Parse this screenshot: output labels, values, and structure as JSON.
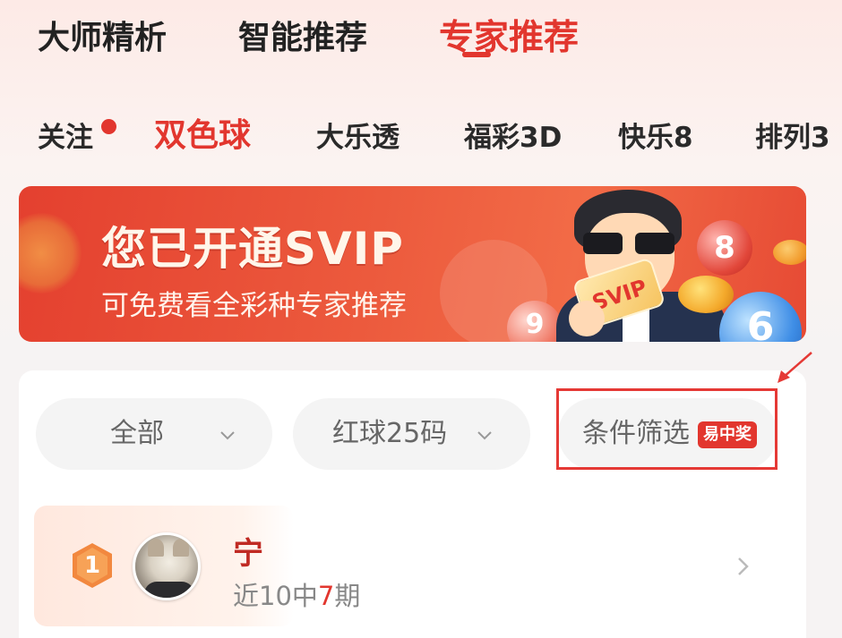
{
  "main_tabs": [
    "大师精析",
    "智能推荐",
    "专家推荐"
  ],
  "main_tab_active_index": 2,
  "lottery_tabs": [
    "关注",
    "双色球",
    "大乐透",
    "福彩3D",
    "快乐8",
    "排列3"
  ],
  "lottery_tab_active_index": 1,
  "banner": {
    "title": "您已开通SVIP",
    "subtitle": "可免费看全彩种专家推荐",
    "card_text": "SVIP",
    "balls": [
      "8",
      "6",
      "9"
    ]
  },
  "filters": {
    "category": "全部",
    "mode": "红球25码",
    "condition": "条件筛选",
    "condition_badge": "易中奖"
  },
  "experts": [
    {
      "rank": "1",
      "name": "宁",
      "stat_prefix": "近10中",
      "stat_hits": "7",
      "stat_suffix": "期"
    }
  ],
  "colors": {
    "accent": "#e2362e",
    "annotation": "#e53935"
  }
}
